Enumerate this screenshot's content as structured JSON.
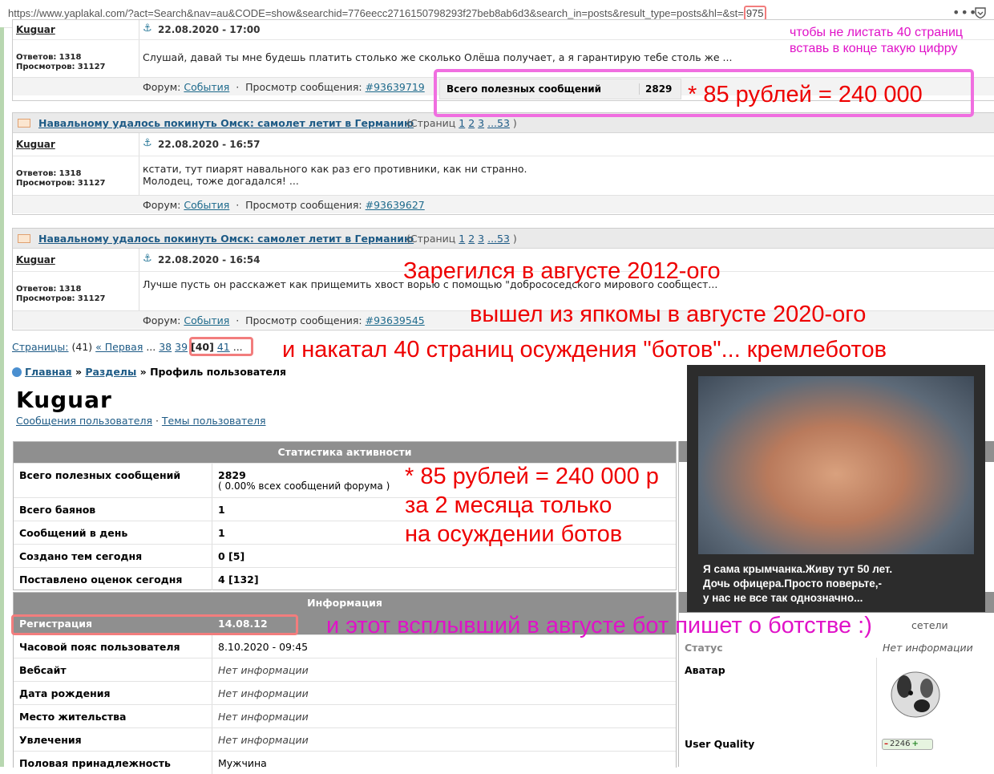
{
  "browser": {
    "url_main": "https://www.yaplakal.com/?act=Search&nav=au&CODE=show&searchid=776eecc2716150798293f27beb8ab6d3&search_in=posts&result_type=posts&hl=&st=",
    "url_st": "975",
    "menu_icon": "dots-icon",
    "shield_icon": "shield-icon"
  },
  "posts": [
    {
      "title": "",
      "pages_prefix": "",
      "pages": [],
      "pages_suffix": "",
      "author": "Kuguar",
      "date": "22.08.2020 - 17:00",
      "stats_replies_label": "Ответов:",
      "stats_replies": "1318",
      "stats_views_label": "Просмотров:",
      "stats_views": "31127",
      "text_lines": [
        "Слушай, давай ты мне будешь платить столько же сколько Олёша получает, а я гарантирую тебе столь же ..."
      ],
      "forum_label": "Форум:",
      "forum": "События",
      "view_label": "Просмотр сообщения:",
      "msg_id": "#93639719"
    },
    {
      "title": "Навальному удалось покинуть Омск: самолет летит в Германию",
      "pages_prefix": "(Страниц",
      "pages": [
        "1",
        "2",
        "3",
        "...53"
      ],
      "pages_suffix": ")",
      "author": "Kuguar",
      "date": "22.08.2020 - 16:57",
      "stats_replies_label": "Ответов:",
      "stats_replies": "1318",
      "stats_views_label": "Просмотров:",
      "stats_views": "31127",
      "text_lines": [
        "кстати, тут пиарят навального как раз его противники, как ни странно.",
        "Молодец, тоже догадался! ..."
      ],
      "forum_label": "Форум:",
      "forum": "События",
      "view_label": "Просмотр сообщения:",
      "msg_id": "#93639627"
    },
    {
      "title": "Навальному удалось покинуть Омск: самолет летит в Германию",
      "pages_prefix": "(Страниц",
      "pages": [
        "1",
        "2",
        "3",
        "...53"
      ],
      "pages_suffix": ")",
      "author": "Kuguar",
      "date": "22.08.2020 - 16:54",
      "stats_replies_label": "Ответов:",
      "stats_replies": "1318",
      "stats_views_label": "Просмотров:",
      "stats_views": "31127",
      "text_lines": [
        "Лучше пусть он расскажет как прищемить хвост ворью с помощью \"добрососедского мирового сообщест..."
      ],
      "forum_label": "Форум:",
      "forum": "События",
      "view_label": "Просмотр сообщения:",
      "msg_id": "#93639545"
    }
  ],
  "pagination": {
    "label": "Страницы:",
    "count": "(41)",
    "first": "« Первая",
    "ellipsis1": "...",
    "p38": "38",
    "p39": "39",
    "current": "[40]",
    "p41": "41",
    "ellipsis2": "..."
  },
  "breadcrumb": {
    "home": "Главная",
    "sep": "»",
    "sections": "Разделы",
    "current": "Профиль пользователя"
  },
  "profile": {
    "name": "Kuguar",
    "link_messages": "Сообщения пользователя",
    "dot": "·",
    "link_topics": "Темы пользователя"
  },
  "activity": {
    "header": "Статистика активности",
    "rows": [
      {
        "k": "Всего полезных сообщений",
        "v": "2829",
        "v2": "( 0.00% всех сообщений форума )"
      },
      {
        "k": "Всего баянов",
        "v": "1",
        "v2": ""
      },
      {
        "k": "Сообщений в день",
        "v": "1",
        "v2": ""
      },
      {
        "k": "Создано тем сегодня",
        "v": "0 [5]",
        "v2": ""
      },
      {
        "k": "Поставлено оценок сегодня",
        "v": "4 [132]",
        "v2": ""
      }
    ]
  },
  "info": {
    "header": "Информация",
    "reg_label": "Регистрация",
    "reg_value": "14.08.12",
    "rows": [
      {
        "k": "Часовой пояс пользователя",
        "v": "8.10.2020 - 09:45",
        "italic": false
      },
      {
        "k": "Вебсайт",
        "v": "Нет информации",
        "italic": true
      },
      {
        "k": "Дата рождения",
        "v": "Нет информации",
        "italic": true
      },
      {
        "k": "Место жительства",
        "v": "Нет информации",
        "italic": true
      },
      {
        "k": "Увлечения",
        "v": "Нет информации",
        "italic": true
      },
      {
        "k": "Половая принадлежность",
        "v": "Мужчина",
        "italic": false
      }
    ]
  },
  "right_panel": {
    "partial": "сетели",
    "status_label": "Статус",
    "status_value": "Нет информации",
    "avatar_label": "Аватар",
    "uq_label": "User Quality",
    "uq_minus": "–",
    "uq_value": "2246",
    "uq_plus": "+"
  },
  "stat_popup": {
    "label": "Всего полезных сообщений",
    "value": "2829"
  },
  "annotations": {
    "hint1": "чтобы не листать 40 страниц",
    "hint2": "вставь в конце такую цифру",
    "formula": "* 85 рублей = 240 000",
    "registered": "Зарегился в августе 2012-ого",
    "left_yap": "вышел из япкомы в августе 2020-ого",
    "rolled": "и накатал 40 страниц осуждения \"ботов\"... кремлеботов",
    "formula2": "* 85 рублей = 240 000 р",
    "months": "за 2 месяца только",
    "on_bots": "на осуждении ботов",
    "popped": "и этот всплывший в августе бот пишет о ботстве :)"
  },
  "photo": {
    "caption1": "Я сама крымчанка.Живу тут 50 лет.",
    "caption2": "Дочь офицера.Просто поверьте,-",
    "caption3": "у нас не все так однозначно..."
  },
  "colors": {
    "annotation_red": "#e00000",
    "annotation_pink": "#e012c8",
    "link_blue": "#1e5b86",
    "header_gray": "#8f8f8f"
  }
}
